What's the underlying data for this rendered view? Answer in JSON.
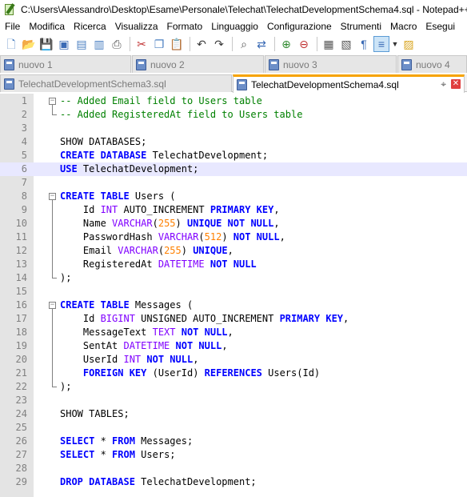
{
  "window": {
    "title": "C:\\Users\\Alessandro\\Desktop\\Esame\\Personale\\Telechat\\TelechatDevelopmentSchema4.sql - Notepad++"
  },
  "menu": [
    "File",
    "Modifica",
    "Ricerca",
    "Visualizza",
    "Formato",
    "Linguaggio",
    "Configurazione",
    "Strumenti",
    "Macro",
    "Esegui"
  ],
  "toolbar": [
    "new-file",
    "open-file",
    "save",
    "save-all",
    "close",
    "close-all",
    "print",
    "cut",
    "copy",
    "paste",
    "undo",
    "redo",
    "find",
    "replace",
    "zoom-in",
    "zoom-out",
    "sync-scroll",
    "word-wrap",
    "show-all-chars",
    "indent-guide",
    "user-defined-language"
  ],
  "tabs_row1": [
    {
      "label": "nuovo 1"
    },
    {
      "label": "nuovo 2"
    },
    {
      "label": "nuovo 3"
    },
    {
      "label": "nuovo 4"
    }
  ],
  "tabs_row2": [
    {
      "label": "TelechatDevelopmentSchema3.sql",
      "active": false
    },
    {
      "label": "TelechatDevelopmentSchema4.sql",
      "active": true
    }
  ],
  "editor": {
    "current_line": 6,
    "lines": [
      [
        [
          "-- Added Email field to Users table",
          "comment"
        ]
      ],
      [
        [
          "-- Added RegisteredAt field to Users table",
          "comment"
        ]
      ],
      [],
      [
        [
          "SHOW DATABASES;",
          "plain"
        ]
      ],
      [
        [
          "CREATE DATABASE",
          "kw"
        ],
        [
          " TelechatDevelopment;",
          "plain"
        ]
      ],
      [
        [
          "USE",
          "kw"
        ],
        [
          " TelechatDevelopment;",
          "plain"
        ]
      ],
      [],
      [
        [
          "CREATE TABLE",
          "kw"
        ],
        [
          " Users (",
          "plain"
        ]
      ],
      [
        [
          "    Id ",
          "plain"
        ],
        [
          "INT",
          "type"
        ],
        [
          " AUTO_INCREMENT ",
          "plain"
        ],
        [
          "PRIMARY KEY",
          "kw"
        ],
        [
          ",",
          "plain"
        ]
      ],
      [
        [
          "    Name ",
          "plain"
        ],
        [
          "VARCHAR",
          "type"
        ],
        [
          "(",
          "plain"
        ],
        [
          "255",
          "num"
        ],
        [
          ") ",
          "plain"
        ],
        [
          "UNIQUE NOT NULL",
          "kw"
        ],
        [
          ",",
          "plain"
        ]
      ],
      [
        [
          "    PasswordHash ",
          "plain"
        ],
        [
          "VARCHAR",
          "type"
        ],
        [
          "(",
          "plain"
        ],
        [
          "512",
          "num"
        ],
        [
          ") ",
          "plain"
        ],
        [
          "NOT NULL",
          "kw"
        ],
        [
          ",",
          "plain"
        ]
      ],
      [
        [
          "    Email ",
          "plain"
        ],
        [
          "VARCHAR",
          "type"
        ],
        [
          "(",
          "plain"
        ],
        [
          "255",
          "num"
        ],
        [
          ") ",
          "plain"
        ],
        [
          "UNIQUE",
          "kw"
        ],
        [
          ",",
          "plain"
        ]
      ],
      [
        [
          "    RegisteredAt ",
          "plain"
        ],
        [
          "DATETIME",
          "type"
        ],
        [
          " ",
          "plain"
        ],
        [
          "NOT NULL",
          "kw"
        ]
      ],
      [
        [
          ");",
          "plain"
        ]
      ],
      [],
      [
        [
          "CREATE TABLE",
          "kw"
        ],
        [
          " Messages (",
          "plain"
        ]
      ],
      [
        [
          "    Id ",
          "plain"
        ],
        [
          "BIGINT",
          "type"
        ],
        [
          " UNSIGNED AUTO_INCREMENT ",
          "plain"
        ],
        [
          "PRIMARY KEY",
          "kw"
        ],
        [
          ",",
          "plain"
        ]
      ],
      [
        [
          "    MessageText ",
          "plain"
        ],
        [
          "TEXT",
          "type"
        ],
        [
          " ",
          "plain"
        ],
        [
          "NOT NULL",
          "kw"
        ],
        [
          ",",
          "plain"
        ]
      ],
      [
        [
          "    SentAt ",
          "plain"
        ],
        [
          "DATETIME",
          "type"
        ],
        [
          " ",
          "plain"
        ],
        [
          "NOT NULL",
          "kw"
        ],
        [
          ",",
          "plain"
        ]
      ],
      [
        [
          "    UserId ",
          "plain"
        ],
        [
          "INT",
          "type"
        ],
        [
          " ",
          "plain"
        ],
        [
          "NOT NULL",
          "kw"
        ],
        [
          ",",
          "plain"
        ]
      ],
      [
        [
          "    ",
          "plain"
        ],
        [
          "FOREIGN KEY",
          "kw"
        ],
        [
          " (UserId) ",
          "plain"
        ],
        [
          "REFERENCES",
          "kw"
        ],
        [
          " Users(Id)",
          "plain"
        ]
      ],
      [
        [
          ");",
          "plain"
        ]
      ],
      [],
      [
        [
          "SHOW TABLES;",
          "plain"
        ]
      ],
      [],
      [
        [
          "SELECT",
          "kw"
        ],
        [
          " * ",
          "plain"
        ],
        [
          "FROM",
          "kw"
        ],
        [
          " Messages;",
          "plain"
        ]
      ],
      [
        [
          "SELECT",
          "kw"
        ],
        [
          " * ",
          "plain"
        ],
        [
          "FROM",
          "kw"
        ],
        [
          " Users;",
          "plain"
        ]
      ],
      [],
      [
        [
          "DROP DATABASE",
          "kw"
        ],
        [
          " TelechatDevelopment;",
          "plain"
        ]
      ]
    ]
  }
}
